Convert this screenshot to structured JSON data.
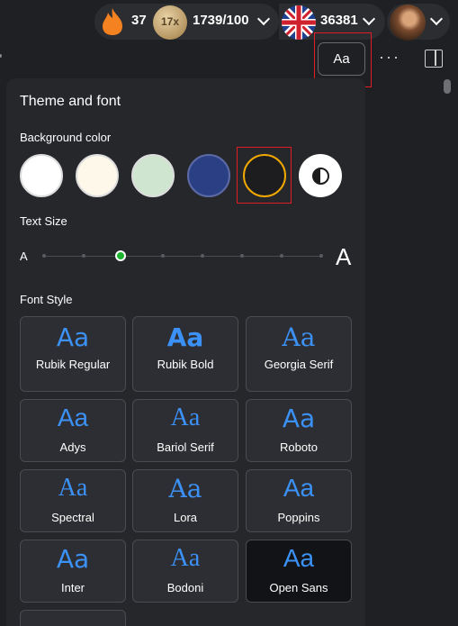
{
  "header": {
    "streak_count": "37",
    "multiplier": "17x",
    "progress": "1739/100",
    "language_points": "36381",
    "icons": [
      "flame-icon",
      "coin-icon",
      "uk-flag-icon",
      "chevron-down-icon",
      "avatar"
    ]
  },
  "toolbar": {
    "font_button_label": "Aa",
    "more_label": "···"
  },
  "panel": {
    "title": "Theme and font",
    "background_label": "Background color",
    "background_colors": [
      "#ffffff",
      "#fdf8ea",
      "#cfe5d0",
      "#2b3f84",
      "#1d1d20"
    ],
    "selected_background": 4,
    "selection_ring_color": "#f0a800",
    "text_size_label": "Text Size",
    "text_size_small": "A",
    "text_size_large": "A",
    "text_size_steps": 8,
    "text_size_selected_step": 3,
    "font_style_label": "Font Style",
    "fonts": [
      {
        "sample": "Aa",
        "name": "Rubik Regular"
      },
      {
        "sample": "Aa",
        "name": "Rubik Bold"
      },
      {
        "sample": "Aa",
        "name": "Georgia Serif"
      },
      {
        "sample": "Aa",
        "name": "Adys"
      },
      {
        "sample": "Aa",
        "name": "Bariol Serif"
      },
      {
        "sample": "Aa",
        "name": "Roboto"
      },
      {
        "sample": "Aa",
        "name": "Spectral"
      },
      {
        "sample": "Aa",
        "name": "Lora"
      },
      {
        "sample": "Aa",
        "name": "Poppins"
      },
      {
        "sample": "Aa",
        "name": "Inter"
      },
      {
        "sample": "Aa",
        "name": "Bodoni"
      },
      {
        "sample": "Aa",
        "name": "Open Sans"
      }
    ],
    "selected_font": 11,
    "accent_color": "#3b91f5",
    "slider_color": "#1db32f"
  }
}
